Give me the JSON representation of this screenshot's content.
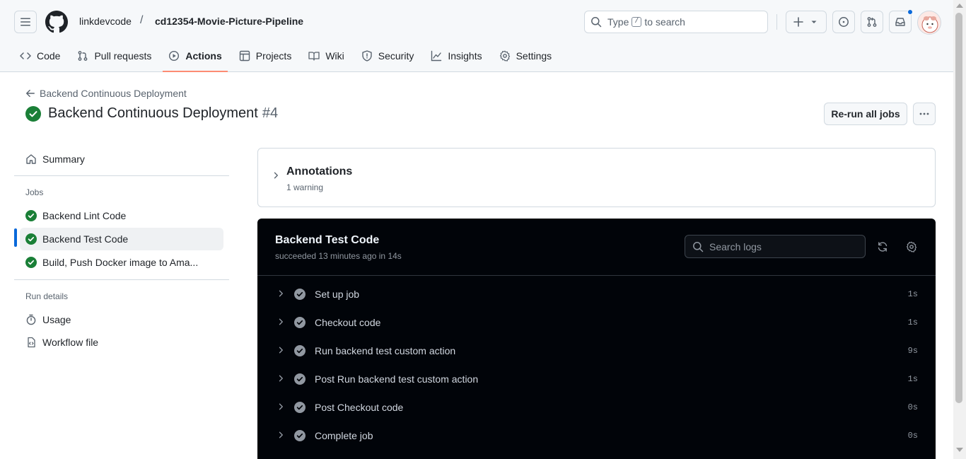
{
  "header": {
    "owner": "linkdevcode",
    "separator": "/",
    "repo": "cd12354-Movie-Picture-Pipeline",
    "search_prefix": "Type",
    "search_key": "/",
    "search_suffix": "to search"
  },
  "repo_nav": {
    "tabs": [
      {
        "label": "Code",
        "icon": "code-icon"
      },
      {
        "label": "Pull requests",
        "icon": "pull-request-icon"
      },
      {
        "label": "Actions",
        "icon": "play-icon",
        "active": true
      },
      {
        "label": "Projects",
        "icon": "table-icon"
      },
      {
        "label": "Wiki",
        "icon": "book-icon"
      },
      {
        "label": "Security",
        "icon": "shield-icon"
      },
      {
        "label": "Insights",
        "icon": "graph-icon"
      },
      {
        "label": "Settings",
        "icon": "gear-icon"
      }
    ]
  },
  "run": {
    "back_label": "Backend Continuous Deployment",
    "title": "Backend Continuous Deployment",
    "number": "#4",
    "rerun_label": "Re-run all jobs",
    "more_label": "···"
  },
  "sidebar": {
    "summary": "Summary",
    "jobs_heading": "Jobs",
    "jobs": [
      {
        "label": "Backend Lint Code",
        "status": "success"
      },
      {
        "label": "Backend Test Code",
        "status": "success",
        "selected": true
      },
      {
        "label": "Build, Push Docker image to Ama...",
        "status": "success"
      }
    ],
    "run_details_heading": "Run details",
    "usage": "Usage",
    "workflow_file": "Workflow file"
  },
  "annotations": {
    "title": "Annotations",
    "subtitle": "1 warning"
  },
  "log": {
    "title": "Backend Test Code",
    "subtitle": "succeeded 13 minutes ago in 14s",
    "search_placeholder": "Search logs",
    "steps": [
      {
        "label": "Set up job",
        "time": "1s"
      },
      {
        "label": "Checkout code",
        "time": "1s"
      },
      {
        "label": "Run backend test custom action",
        "time": "9s"
      },
      {
        "label": "Post Run backend test custom action",
        "time": "1s"
      },
      {
        "label": "Post Checkout code",
        "time": "0s"
      },
      {
        "label": "Complete job",
        "time": "0s"
      }
    ]
  },
  "colors": {
    "success": "#1a7f37",
    "accent_underline": "#fd8c73",
    "selected_indicator": "#0969da",
    "log_bg": "#010409"
  }
}
